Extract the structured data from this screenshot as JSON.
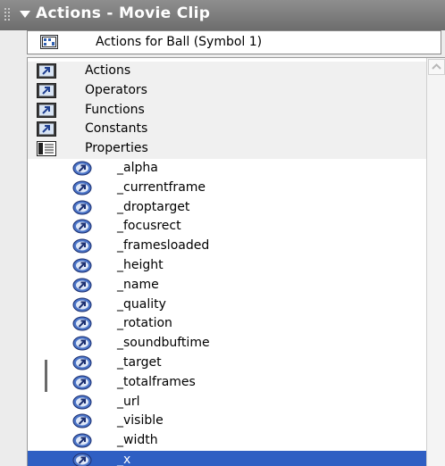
{
  "panel": {
    "title": "Actions - Movie Clip"
  },
  "target": {
    "label": "Actions for Ball  (Symbol 1)"
  },
  "categories": [
    {
      "label": "Actions",
      "icon": "book-arrow-icon"
    },
    {
      "label": "Operators",
      "icon": "book-arrow-icon"
    },
    {
      "label": "Functions",
      "icon": "book-arrow-icon"
    },
    {
      "label": "Constants",
      "icon": "book-arrow-icon"
    },
    {
      "label": "Properties",
      "icon": "open-book-icon"
    }
  ],
  "properties": [
    "_alpha",
    "_currentframe",
    "_droptarget",
    "_focusrect",
    "_framesloaded",
    "_height",
    "_name",
    "_quality",
    "_rotation",
    "_soundbuftime",
    "_target",
    "_totalframes",
    "_url",
    "_visible",
    "_width",
    "_x"
  ],
  "selected_property": "_x",
  "colors": {
    "title_bar": "#7a7a7a",
    "selection": "#2f5fc3",
    "icon_blue": "#4a74c8"
  }
}
